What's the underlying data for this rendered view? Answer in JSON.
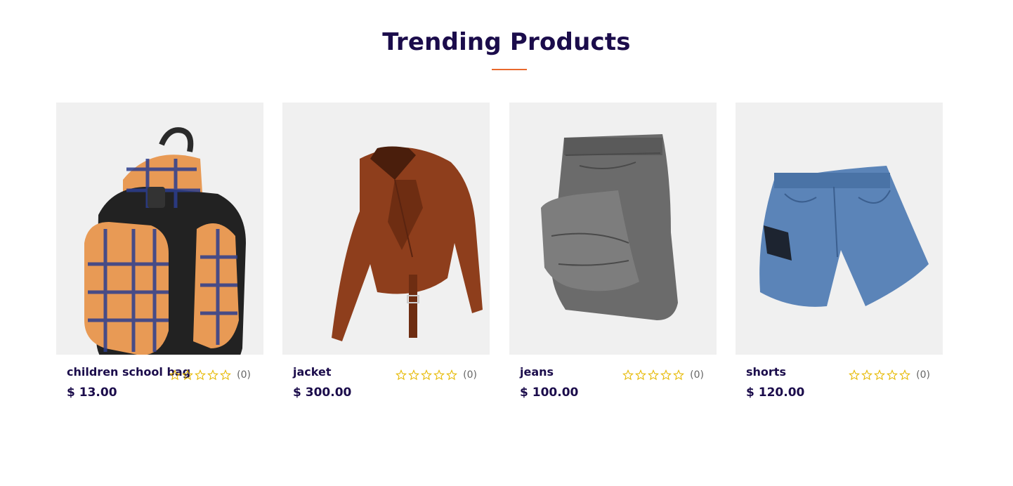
{
  "section": {
    "title": "Trending Products",
    "accent": "#e8692d"
  },
  "products": [
    {
      "name": "children school bag",
      "price": "$ 13.00",
      "rating_count": "(0)",
      "rating": 0,
      "image": "backpack-image"
    },
    {
      "name": "jacket",
      "price": "$ 300.00",
      "rating_count": "(0)",
      "rating": 0,
      "image": "leather-jacket-image"
    },
    {
      "name": "jeans",
      "price": "$ 100.00",
      "rating_count": "(0)",
      "rating": 0,
      "image": "folded-jeans-image"
    },
    {
      "name": "shorts",
      "price": "$ 120.00",
      "rating_count": "(0)",
      "rating": 0,
      "image": "denim-shorts-image"
    }
  ],
  "colors": {
    "heading": "#1b0c4b",
    "star_outline": "#e6b800",
    "thumb_bg": "#f0f0f0"
  }
}
